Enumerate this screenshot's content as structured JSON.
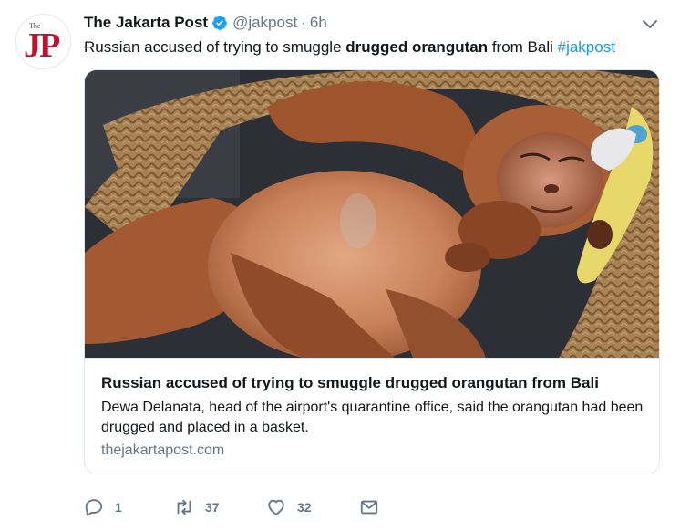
{
  "tweet": {
    "author_name": "The Jakarta Post",
    "handle": "@jakpost",
    "separator": "·",
    "time": "6h",
    "avatar_small_text": "The",
    "avatar_big_text": "JP",
    "text_before": "Russian accused of trying to smuggle ",
    "text_bold": "drugged orangutan",
    "text_after": " from Bali ",
    "hashtag": "#jakpost"
  },
  "card": {
    "title": "Russian accused of trying to smuggle drugged orangutan from Bali",
    "description": "Dewa Delanata, head of the airport's quarantine office, said the orangutan had been drugged and placed in a basket.",
    "url": "thejakartapost.com"
  },
  "actions": {
    "reply_count": "1",
    "retweet_count": "37",
    "like_count": "32"
  },
  "icons": {
    "verified": "verified-badge-icon",
    "caret": "chevron-down-icon",
    "reply": "reply-icon",
    "retweet": "retweet-icon",
    "like": "heart-icon",
    "message": "direct-message-icon"
  },
  "colors": {
    "accent": "#1b95e0",
    "secondary_text": "#657786",
    "brand_red": "#c8102e"
  }
}
